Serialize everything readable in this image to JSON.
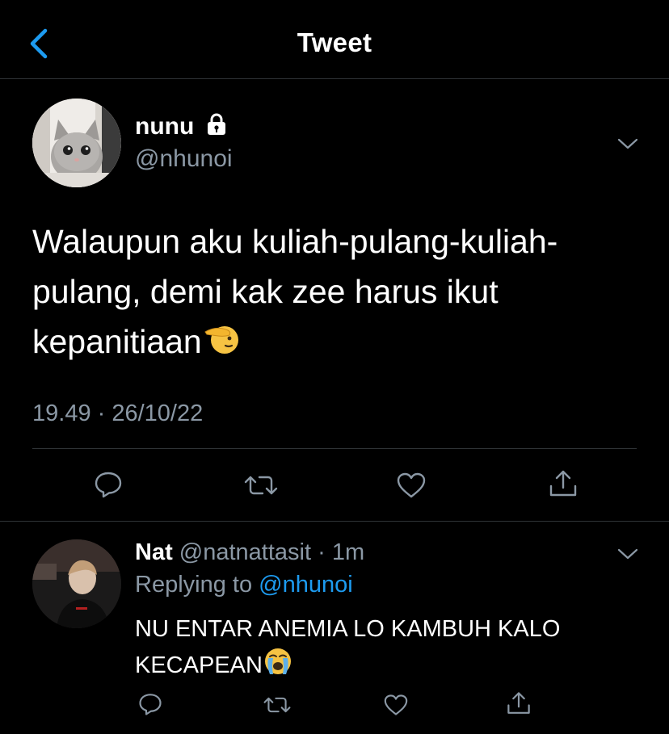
{
  "header": {
    "title": "Tweet"
  },
  "tweet": {
    "author_name": "nunu",
    "author_handle": "@nhunoi",
    "text_lines": [
      "Walaupun aku kuliah-pulang-kuliah-",
      "pulang, demi kak zee harus ikut",
      "kepanitiaan"
    ],
    "timestamp": "19.49 · 26/10/22"
  },
  "reply": {
    "author_name": "Nat",
    "author_handle": "@natnattasit",
    "separator": " · ",
    "time_ago": "1m",
    "replying_prefix": "Replying to ",
    "replying_to": "@nhunoi",
    "text_lines": [
      "NU ENTAR ANEMIA LO KAMBUH KALO",
      "KECAPEAN"
    ]
  },
  "icons": {
    "back": "chevron-left-icon",
    "locked": "lock-icon",
    "more": "chevron-down-icon",
    "reply": "reply-icon",
    "retweet": "retweet-icon",
    "like": "heart-icon",
    "share": "share-icon",
    "emoji_tweet": "saluting-face-emoji",
    "emoji_reply": "loudly-crying-face-emoji"
  },
  "colors": {
    "background": "#000000",
    "text": "#ffffff",
    "muted": "#8b98a5",
    "accent": "#1d9bf0",
    "divider": "#2f3336"
  }
}
